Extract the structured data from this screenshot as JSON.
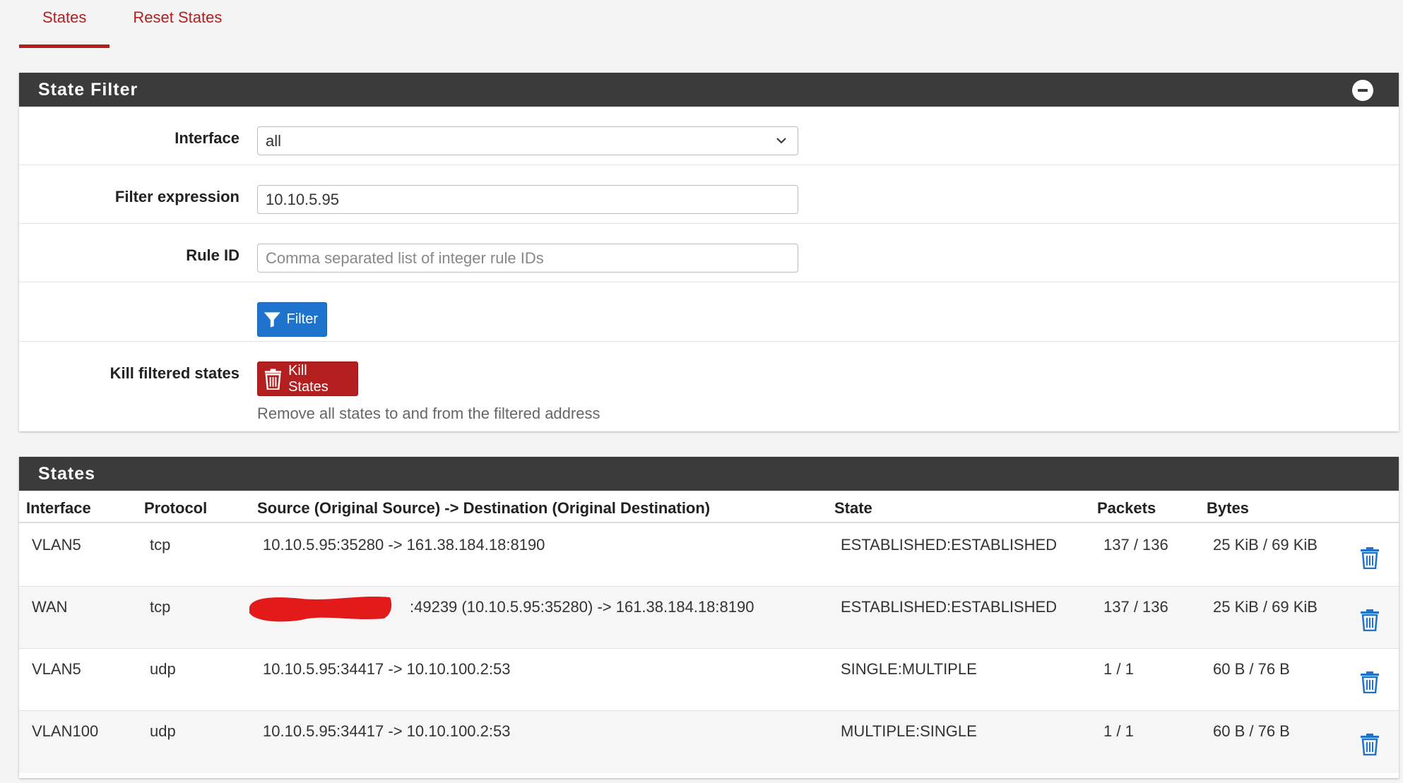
{
  "tabs": [
    {
      "label": "States",
      "active": true
    },
    {
      "label": "Reset States",
      "active": false
    }
  ],
  "state_filter": {
    "title": "State Filter",
    "interface_label": "Interface",
    "interface_value": "all",
    "filter_expression_label": "Filter expression",
    "filter_expression_value": "10.10.5.95",
    "rule_id_label": "Rule ID",
    "rule_id_placeholder": "Comma separated list of integer rule IDs",
    "filter_button": "Filter",
    "kill_label": "Kill filtered states",
    "kill_button": "Kill States",
    "kill_help": "Remove all states to and from the filtered address"
  },
  "states": {
    "title": "States",
    "columns": [
      "Interface",
      "Protocol",
      "Source (Original Source) -> Destination (Original Destination)",
      "State",
      "Packets",
      "Bytes"
    ],
    "rows": [
      {
        "interface": "VLAN5",
        "protocol": "tcp",
        "flow": "10.10.5.95:35280 -> 161.38.184.18:8190",
        "state": "ESTABLISHED:ESTABLISHED",
        "packets": "137 / 136",
        "bytes": "25 KiB / 69 KiB"
      },
      {
        "interface": "WAN",
        "protocol": "tcp",
        "flow": ":49239 (10.10.5.95:35280) -> 161.38.184.18:8190",
        "state": "ESTABLISHED:ESTABLISHED",
        "packets": "137 / 136",
        "bytes": "25 KiB / 69 KiB"
      },
      {
        "interface": "VLAN5",
        "protocol": "udp",
        "flow": "10.10.5.95:34417 -> 10.10.100.2:53",
        "state": "SINGLE:MULTIPLE",
        "packets": "1 / 1",
        "bytes": "60 B / 76 B"
      },
      {
        "interface": "VLAN100",
        "protocol": "udp",
        "flow": "10.10.5.95:34417 -> 10.10.100.2:53",
        "state": "MULTIPLE:SINGLE",
        "packets": "1 / 1",
        "bytes": "60 B / 76 B"
      }
    ]
  },
  "colors": {
    "accent_red": "#b31e1e",
    "button_blue": "#1e73cc",
    "panel_header": "#3b3b3b",
    "trash_blue": "#1e73cc"
  }
}
